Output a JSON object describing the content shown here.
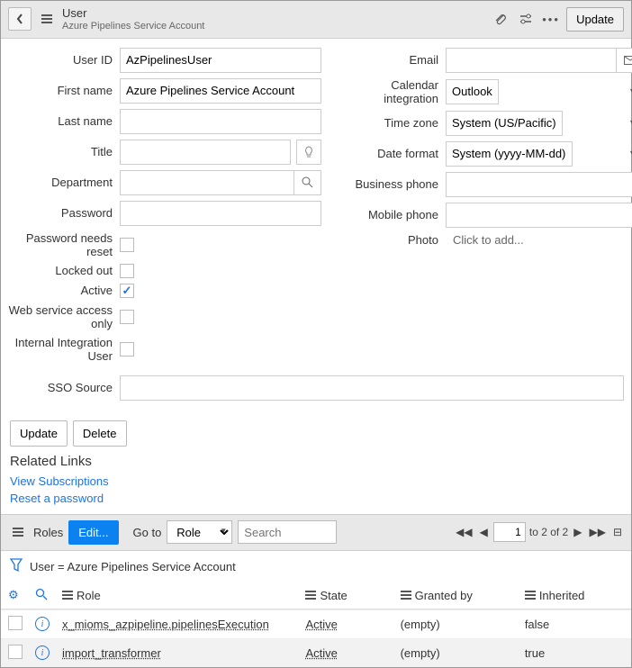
{
  "header": {
    "title": "User",
    "subtitle": "Azure Pipelines Service Account",
    "update": "Update"
  },
  "form": {
    "left": {
      "userId": {
        "label": "User ID",
        "value": "AzPipelinesUser"
      },
      "firstName": {
        "label": "First name",
        "value": "Azure Pipelines Service Account"
      },
      "lastName": {
        "label": "Last name",
        "value": ""
      },
      "title": {
        "label": "Title",
        "value": ""
      },
      "department": {
        "label": "Department",
        "value": ""
      },
      "password": {
        "label": "Password",
        "value": ""
      },
      "pwReset": {
        "label": "Password needs reset",
        "checked": false
      },
      "locked": {
        "label": "Locked out",
        "checked": false
      },
      "active": {
        "label": "Active",
        "checked": true
      },
      "webOnly": {
        "label": "Web service access only",
        "checked": false
      },
      "internal": {
        "label": "Internal Integration User",
        "checked": false
      }
    },
    "right": {
      "email": {
        "label": "Email",
        "value": ""
      },
      "calendar": {
        "label": "Calendar integration",
        "value": "Outlook"
      },
      "timezone": {
        "label": "Time zone",
        "value": "System (US/Pacific)"
      },
      "dateFormat": {
        "label": "Date format",
        "value": "System (yyyy-MM-dd)"
      },
      "bizPhone": {
        "label": "Business phone",
        "value": ""
      },
      "mobPhone": {
        "label": "Mobile phone",
        "value": ""
      },
      "photo": {
        "label": "Photo",
        "value": "Click to add..."
      }
    },
    "sso": {
      "label": "SSO Source",
      "value": ""
    }
  },
  "buttons": {
    "update": "Update",
    "delete": "Delete"
  },
  "links": {
    "head": "Related Links",
    "subs": "View Subscriptions",
    "reset": "Reset a password"
  },
  "roles": {
    "tab": "Roles",
    "edit": "Edit...",
    "goto": "Go to",
    "gotoField": "Role",
    "searchPh": "Search",
    "page": "1",
    "total": "to 2 of 2",
    "filter": "User = Azure Pipelines Service Account",
    "cols": {
      "role": "Role",
      "state": "State",
      "grant": "Granted by",
      "inh": "Inherited"
    },
    "rows": [
      {
        "role": "x_mioms_azpipeline.pipelinesExecution",
        "state": "Active",
        "grant": "(empty)",
        "inh": "false"
      },
      {
        "role": "import_transformer",
        "state": "Active",
        "grant": "(empty)",
        "inh": "true"
      }
    ]
  }
}
